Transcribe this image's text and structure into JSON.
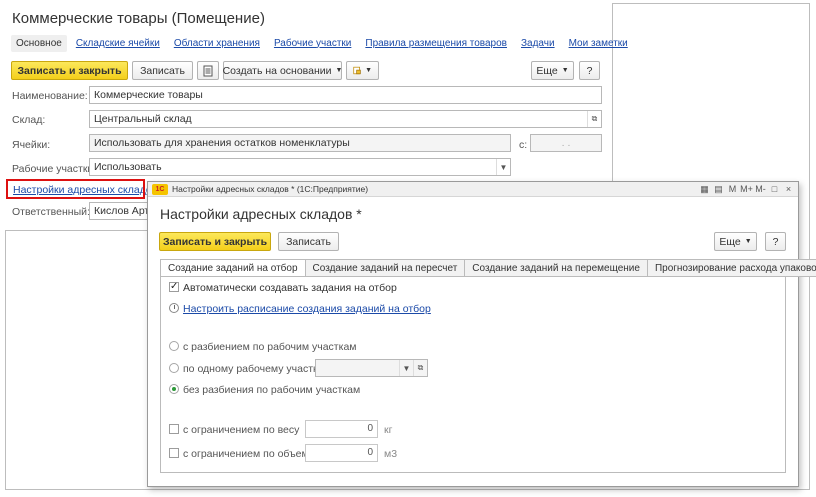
{
  "bg_form": {
    "title": "Коммерческие товары (Помещение)",
    "nav": [
      "Основное",
      "Складские ячейки",
      "Области хранения",
      "Рабочие участки",
      "Правила размещения товаров",
      "Задачи",
      "Мои заметки"
    ],
    "toolbar": {
      "save_close": "Записать и закрыть",
      "save": "Записать",
      "create_based": "Создать на основании",
      "more": "Еще",
      "help": "?"
    },
    "fields": {
      "name_label": "Наименование:",
      "name_value": "Коммерческие товары",
      "warehouse_label": "Склад:",
      "warehouse_value": "Центральный склад",
      "cells_label": "Ячейки:",
      "cells_value": "Использовать для хранения остатков номенклатуры",
      "from_label": "с:",
      "from_value": ". .",
      "areas_label": "Рабочие участки:",
      "areas_value": "Использовать",
      "responsible_label": "Ответственный:",
      "responsible_value": "Кислов Арте"
    },
    "settings_link": "Настройки адресных складов"
  },
  "dialog": {
    "caption": "Настройки адресных складов * (1С:Предприятие)",
    "logo": "1С",
    "window_controls": [
      "M",
      "M+",
      "M-",
      "□",
      "×"
    ],
    "title": "Настройки адресных складов *",
    "toolbar": {
      "save_close": "Записать и закрыть",
      "save": "Записать",
      "more": "Еще",
      "help": "?"
    },
    "tabs": [
      "Создание заданий на отбор",
      "Создание заданий на пересчет",
      "Создание заданий на перемещение",
      "Прогнозирование расхода упаковок"
    ],
    "auto_create_label": "Автоматически создавать задания на отбор",
    "schedule_link": "Настроить расписание создания заданий на отбор",
    "radio_options": [
      "с разбиением по рабочим участкам",
      "по одному рабочему участку",
      "без разбиения по рабочим участкам"
    ],
    "weight_label": "с ограничением по весу",
    "weight_value": "0",
    "weight_unit": "кг",
    "volume_label": "с ограничением по объему",
    "volume_value": "0",
    "volume_unit": "м3"
  }
}
